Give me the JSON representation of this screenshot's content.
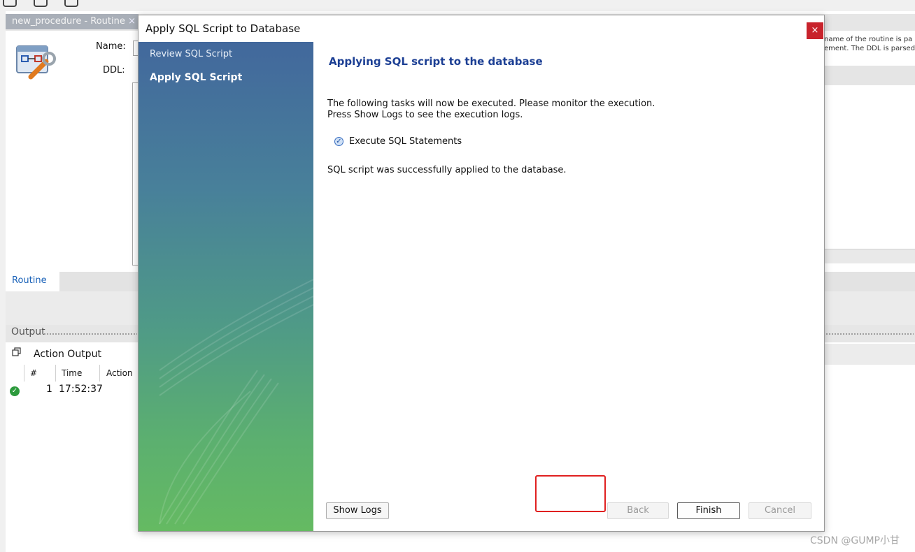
{
  "background": {
    "doc_tab": {
      "title": "new_procedure - Routine",
      "close": "×"
    },
    "form": {
      "name_label": "Name:",
      "ddl_label": "DDL:"
    },
    "description_lines": [
      "name of the routine is pa",
      "ement. The DDL is parsed"
    ],
    "routine_tab": "Routine",
    "output_title": "Output",
    "action_output_label": "Action Output",
    "table": {
      "columns": [
        "#",
        "Time",
        "Action"
      ],
      "rows": [
        {
          "num": "1",
          "time": "17:52:37",
          "status": "success"
        }
      ]
    }
  },
  "dialog": {
    "title": "Apply SQL Script to Database",
    "close": "×",
    "steps": [
      {
        "label": "Review SQL Script",
        "active": false
      },
      {
        "label": "Apply SQL Script",
        "active": true
      }
    ],
    "heading": "Applying SQL script to the database",
    "intro_line1": "The following tasks will now be executed. Please monitor the execution.",
    "intro_line2": "Press Show Logs to see the execution logs.",
    "tasks": [
      {
        "label": "Execute SQL Statements",
        "icon": "check-circle-icon"
      }
    ],
    "status_message": "SQL script was successfully applied to the database.",
    "buttons": {
      "show_logs": "Show Logs",
      "back": "Back",
      "finish": "Finish",
      "cancel": "Cancel"
    }
  },
  "colors": {
    "heading": "#1c3f94",
    "close_button": "#c8232c",
    "highlight": "#e02020",
    "success": "#2c9a3c",
    "routine_tab_text": "#1a62b8"
  },
  "watermark": "CSDN @GUMP小甘"
}
